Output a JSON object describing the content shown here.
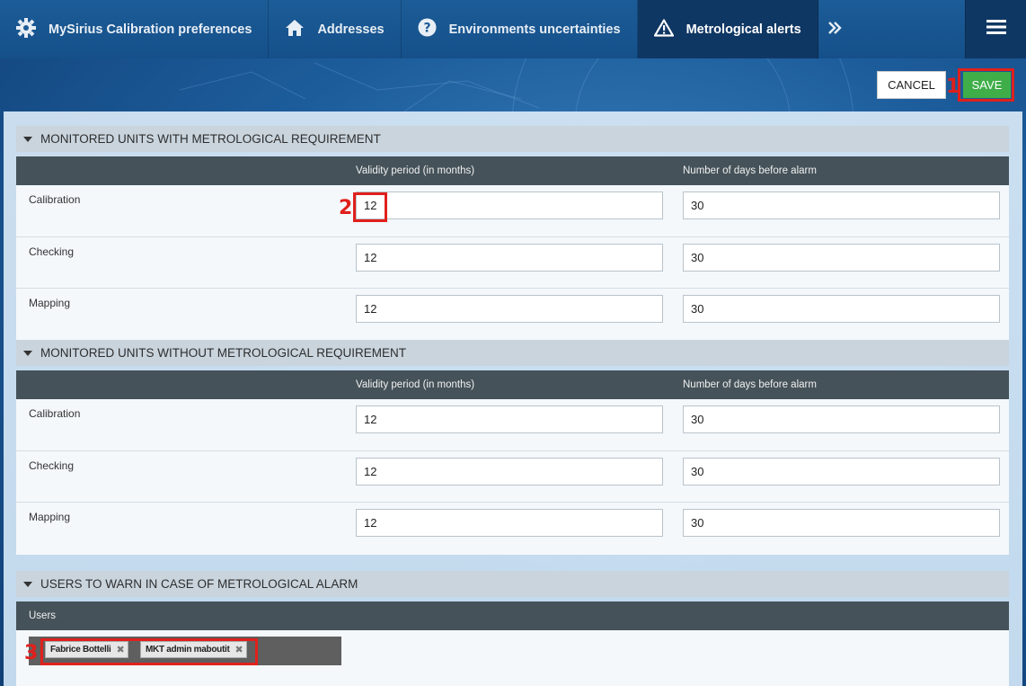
{
  "nav": {
    "tabs": [
      {
        "label": "MySirius Calibration preferences",
        "icon": "gear-icon"
      },
      {
        "label": "Addresses",
        "icon": "home-icon"
      },
      {
        "label": "Environments uncertainties",
        "icon": "question-icon"
      },
      {
        "label": "Metrological alerts",
        "icon": "warning-icon",
        "active": true
      }
    ],
    "more_icon": "double-chevron-right-icon",
    "menu_icon": "hamburger-icon"
  },
  "actions": {
    "cancel": "CANCEL",
    "save": "SAVE"
  },
  "markers": {
    "m1": "1",
    "m2": "2",
    "m3": "3"
  },
  "columns": {
    "validity": "Validity period (in months)",
    "days": "Number of days before alarm"
  },
  "section1": {
    "title": "MONITORED UNITS WITH METROLOGICAL REQUIREMENT",
    "rows": [
      {
        "label": "Calibration",
        "validity": "12",
        "days": "30"
      },
      {
        "label": "Checking",
        "validity": "12",
        "days": "30"
      },
      {
        "label": "Mapping",
        "validity": "12",
        "days": "30"
      }
    ]
  },
  "section2": {
    "title": "MONITORED UNITS WITHOUT METROLOGICAL REQUIREMENT",
    "rows": [
      {
        "label": "Calibration",
        "validity": "12",
        "days": "30"
      },
      {
        "label": "Checking",
        "validity": "12",
        "days": "30"
      },
      {
        "label": "Mapping",
        "validity": "12",
        "days": "30"
      }
    ]
  },
  "section3": {
    "title": "USERS TO WARN IN CASE OF METROLOGICAL ALARM",
    "users_header": "Users",
    "users": [
      "Fabrice Bottelli",
      "MKT admin maboutit"
    ]
  },
  "colors": {
    "save": "#3fae49",
    "highlight": "#e0201c",
    "nav": "#1c5c97",
    "active_tab": "#0f3763",
    "table_header": "#455259"
  }
}
